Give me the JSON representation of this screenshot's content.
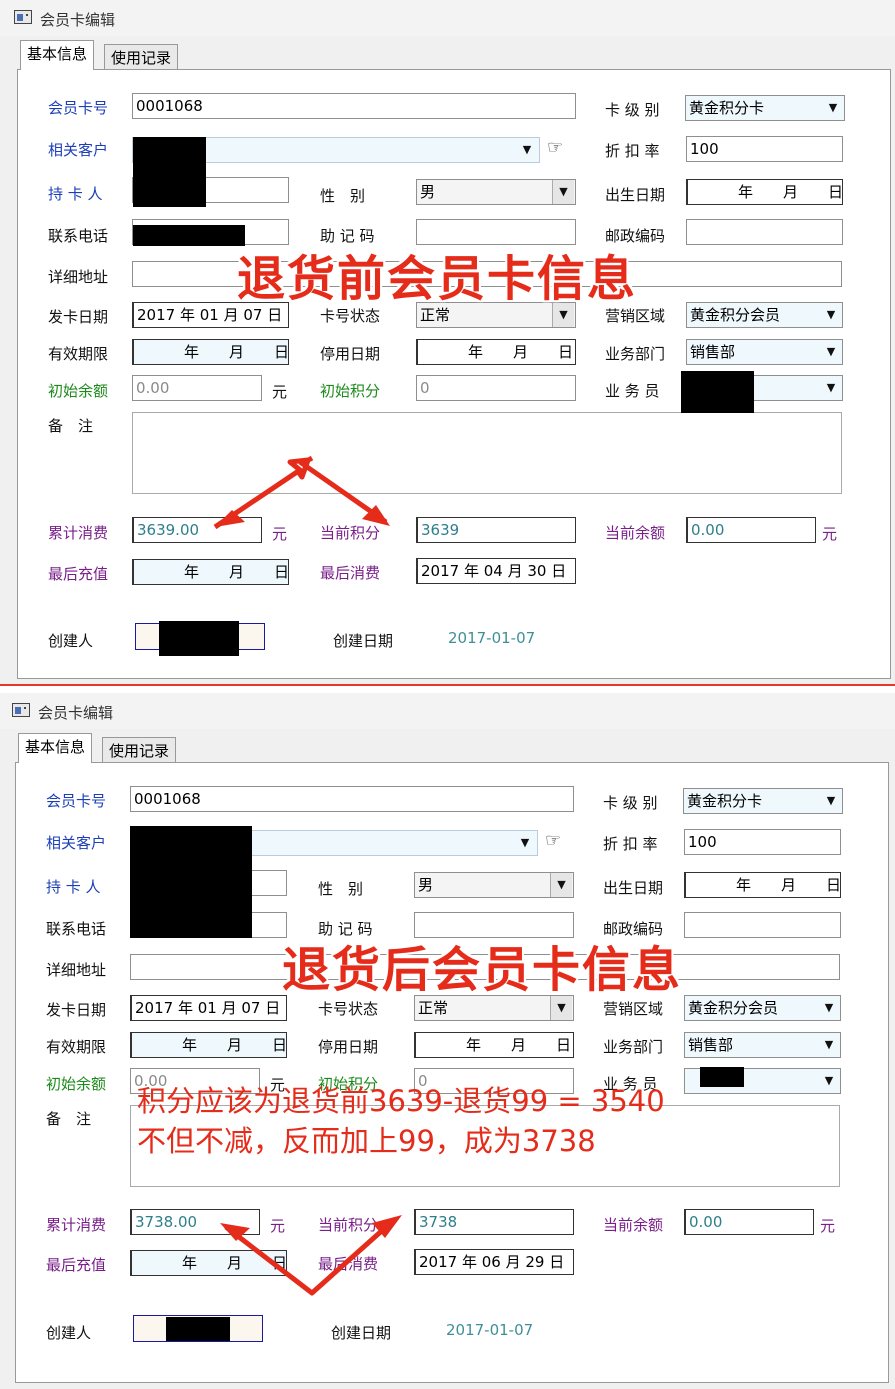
{
  "window": {
    "title": "会员卡编辑",
    "tabs": [
      "基本信息",
      "使用记录"
    ]
  },
  "labels": {
    "card_no": "会员卡号",
    "customer": "相关客户",
    "holder": "持 卡 人",
    "phone": "联系电话",
    "address": "详细地址",
    "issue_date": "发卡日期",
    "valid_until": "有效期限",
    "init_balance": "初始余额",
    "yuan": "元",
    "remark": "备　注",
    "total_spent": "累计消费",
    "last_recharge": "最后充值",
    "creator": "创建人",
    "gender": "性　别",
    "mnemonic": "助 记 码",
    "card_status": "卡号状态",
    "stop_date": "停用日期",
    "init_points": "初始积分",
    "cur_points": "当前积分",
    "last_spent": "最后消费",
    "create_date": "创建日期",
    "card_level": "卡 级 别",
    "discount": "折 扣 率",
    "birth": "出生日期",
    "zip": "邮政编码",
    "region": "营销区域",
    "dept": "业务部门",
    "salesman": "业 务 员",
    "cur_balance": "当前余额"
  },
  "ymd": "年　　月　　日",
  "before": {
    "card_no": "0001068",
    "card_level": "黄金积分卡",
    "discount": "100",
    "gender": "男",
    "issue_date": "2017 年 01 月 07 日",
    "card_status": "正常",
    "region": "黄金积分会员",
    "dept": "销售部",
    "init_balance": "0.00",
    "init_points": "0",
    "total_spent": "3639.00",
    "cur_points": "3639",
    "cur_balance": "0.00",
    "last_spent": "2017 年 04 月 30 日",
    "create_date": "2017-01-07",
    "overlay": "退货前会员卡信息"
  },
  "after": {
    "card_no": "0001068",
    "card_level": "黄金积分卡",
    "discount": "100",
    "gender": "男",
    "issue_date": "2017 年 01 月 07 日",
    "card_status": "正常",
    "region": "黄金积分会员",
    "dept": "销售部",
    "init_balance": "0.00",
    "init_points": "0",
    "total_spent": "3738.00",
    "cur_points": "3738",
    "cur_balance": "0.00",
    "last_spent": "2017 年 06 月 29 日",
    "create_date": "2017-01-07",
    "overlay": "退货后会员卡信息",
    "note_line1": "积分应该为退货前3639-退货99 = 3540",
    "note_line2": "不但不减，反而加上99，成为3738"
  },
  "colors": {
    "annotation": "#e52b1a",
    "label_blue": "#1c3fb8",
    "label_green": "#1b8a1b",
    "label_purple": "#7a1f8a"
  },
  "icons": {
    "window": "window-icon",
    "lookup": "pointing-hand-icon",
    "dropdown": "chevron-down-icon"
  }
}
